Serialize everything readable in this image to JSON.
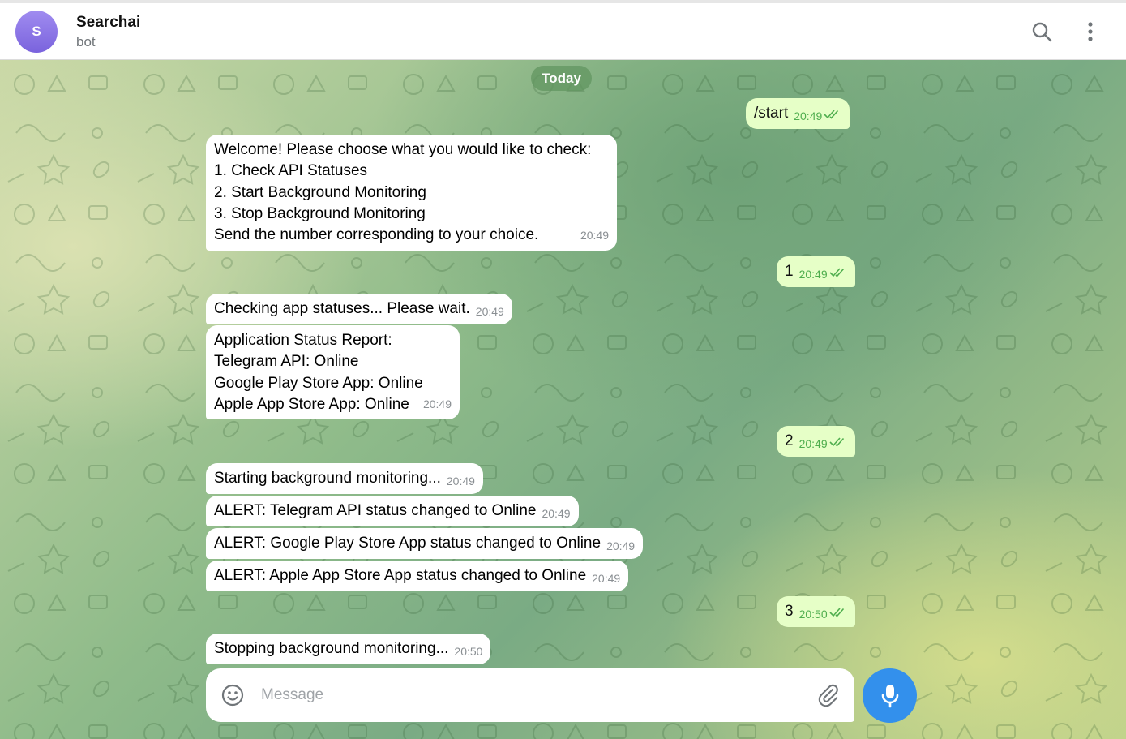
{
  "header": {
    "avatar_letter": "S",
    "title": "Searchai",
    "subtitle": "bot",
    "search_icon": "search-icon",
    "menu_icon": "more-vertical-icon"
  },
  "date_divider": "Today",
  "messages": [
    {
      "direction": "out",
      "text": "/start",
      "time": "20:49",
      "status": "read"
    },
    {
      "direction": "in",
      "text": "Welcome! Please choose what you would like to check:\n1. Check API Statuses\n2. Start Background Monitoring\n3. Stop Background Monitoring\nSend the number corresponding to your choice.",
      "time": "20:49"
    },
    {
      "direction": "out",
      "text": "1",
      "time": "20:49",
      "status": "read"
    },
    {
      "direction": "in",
      "text": "Checking app statuses... Please wait.",
      "time": "20:49"
    },
    {
      "direction": "in",
      "text": "Application Status Report:\nTelegram API: Online\nGoogle Play Store App: Online\nApple App Store App: Online",
      "time": "20:49"
    },
    {
      "direction": "out",
      "text": "2",
      "time": "20:49",
      "status": "read"
    },
    {
      "direction": "in",
      "text": "Starting background monitoring...",
      "time": "20:49"
    },
    {
      "direction": "in",
      "text": "ALERT: Telegram API status changed to Online",
      "time": "20:49"
    },
    {
      "direction": "in",
      "text": "ALERT: Google Play Store App status changed to Online",
      "time": "20:49"
    },
    {
      "direction": "in",
      "text": "ALERT: Apple App Store App status changed to Online",
      "time": "20:49"
    },
    {
      "direction": "out",
      "text": "3",
      "time": "20:50",
      "status": "read"
    },
    {
      "direction": "in",
      "text": "Stopping background monitoring...",
      "time": "20:50"
    }
  ],
  "composer": {
    "placeholder": "Message",
    "emoji_icon": "smile-icon",
    "attach_icon": "paperclip-icon",
    "mic_icon": "microphone-icon"
  },
  "colors": {
    "outgoing_bubble": "#e6ffc7",
    "incoming_bubble": "#ffffff",
    "accent": "#3390ec",
    "read_ticks": "#4fae4e"
  }
}
